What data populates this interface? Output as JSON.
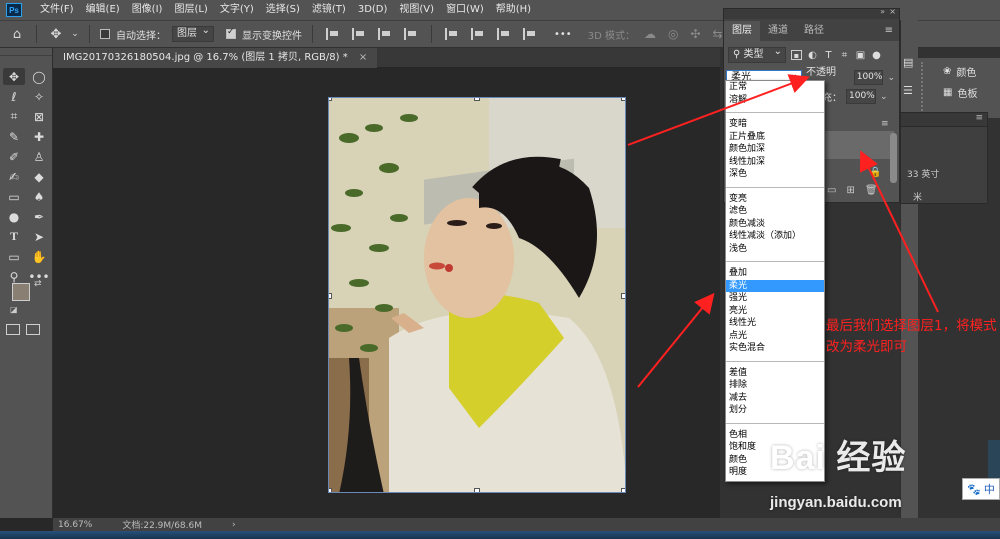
{
  "app": {
    "logo_text": "Ps"
  },
  "menu": {
    "items": [
      "文件(F)",
      "编辑(E)",
      "图像(I)",
      "图层(L)",
      "文字(Y)",
      "选择(S)",
      "滤镜(T)",
      "3D(D)",
      "视图(V)",
      "窗口(W)",
      "帮助(H)"
    ]
  },
  "options_bar": {
    "auto_select_label": "自动选择：",
    "auto_select_target": "图层",
    "show_transform_label": "显示变换控件",
    "mode_3d_label": "3D 模式：",
    "more_label": "•••"
  },
  "document": {
    "tab_title": "IMG20170326180504.jpg @ 16.7% (图层 1 拷贝, RGB/8) *",
    "zoom": "16.67%",
    "doc_size": "文档:22.9M/68.6M"
  },
  "layers_panel": {
    "tabs": [
      "图层",
      "通道",
      "路径"
    ],
    "filter_kind": "类型",
    "blend_mode": "柔光",
    "opacity_label": "不透明度：",
    "opacity_value": "100%",
    "fill_label": "填充：",
    "fill_value": "100%"
  },
  "blend_dropdown": {
    "groups": [
      [
        "正常",
        "溶解"
      ],
      [
        "变暗",
        "正片叠底",
        "颜色加深",
        "线性加深",
        "深色"
      ],
      [
        "变亮",
        "滤色",
        "颜色减淡",
        "线性减淡（添加）",
        "浅色"
      ],
      [
        "叠加",
        "柔光",
        "强光",
        "亮光",
        "线性光",
        "点光",
        "实色混合"
      ],
      [
        "差值",
        "排除",
        "减去",
        "划分"
      ],
      [
        "色相",
        "饱和度",
        "颜色",
        "明度"
      ]
    ],
    "selected": "柔光"
  },
  "side_panels": {
    "color_label": "颜色",
    "swatches_label": "色板",
    "info_line1": "33 英寸",
    "info_line2": "米"
  },
  "annotation": {
    "text": "最后我们选择图层1，将模式改为柔光即可",
    "color": "#ff2020"
  },
  "watermark": {
    "logo": "Bai  经验",
    "url": "jingyan.baidu.com"
  },
  "ime": {
    "label": "中"
  },
  "colors": {
    "foreground": "#8a7f73",
    "background": "#ffffff",
    "selection_blue": "#3399ff",
    "panel_gray": "#535353",
    "canvas_bg": "#282828"
  }
}
